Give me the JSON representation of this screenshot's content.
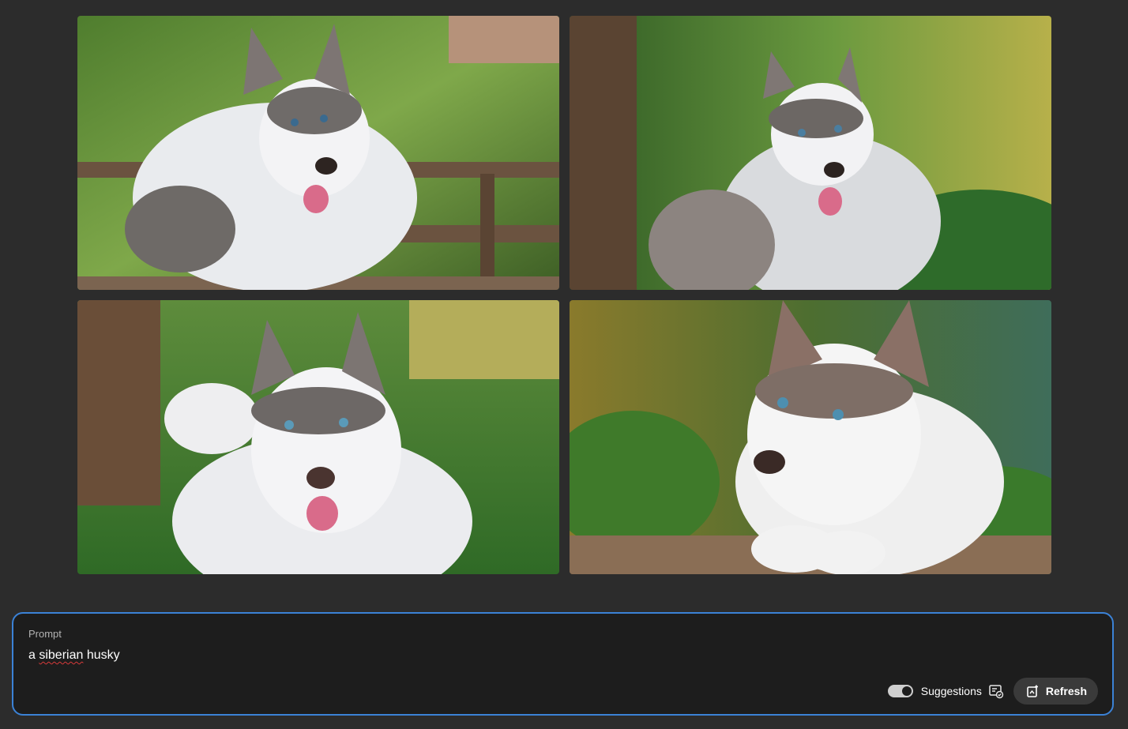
{
  "gallery": {
    "images": [
      {
        "name": "husky-image-1",
        "description": "adult husky lying on wooden deck, tropical plants"
      },
      {
        "name": "husky-image-2",
        "description": "husky puppy sitting in garden near tree trunk"
      },
      {
        "name": "husky-image-3",
        "description": "smiling husky standing among green plants"
      },
      {
        "name": "husky-image-4",
        "description": "husky puppy resting paws on wooden plank"
      }
    ]
  },
  "prompt": {
    "label": "Prompt",
    "value_misspelled": "siberian",
    "value_prefix": "a ",
    "value_suffix": " husky",
    "suggestions_label": "Suggestions",
    "suggestions_enabled": true,
    "refresh_label": "Refresh"
  },
  "colors": {
    "background": "#2c2c2c",
    "panel": "#1d1d1d",
    "focus_border": "#3b82d6",
    "button": "#3a3a3a"
  }
}
